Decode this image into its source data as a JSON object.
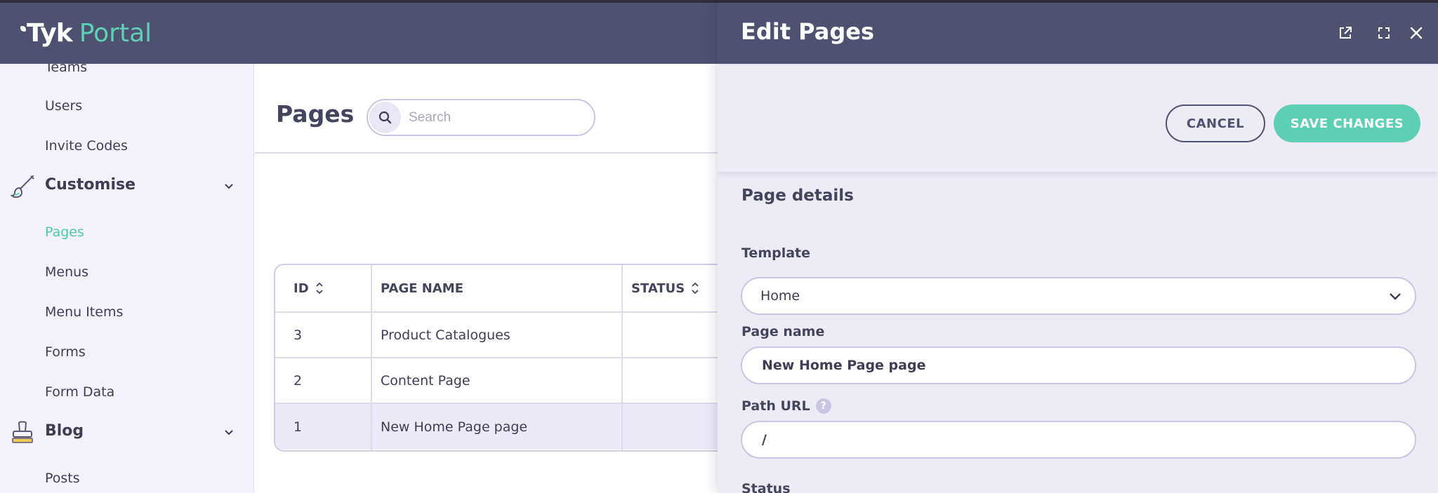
{
  "app": {
    "logo_brand": "Tyk",
    "logo_product": "Portal"
  },
  "sidebar": {
    "items_top": [
      {
        "label": "Teams"
      },
      {
        "label": "Users"
      },
      {
        "label": "Invite Codes"
      }
    ],
    "customise": {
      "label": "Customise",
      "items": [
        {
          "label": "Pages",
          "active": true
        },
        {
          "label": "Menus"
        },
        {
          "label": "Menu Items"
        },
        {
          "label": "Forms"
        },
        {
          "label": "Form Data"
        }
      ]
    },
    "blog": {
      "label": "Blog",
      "items": [
        {
          "label": "Posts"
        }
      ]
    }
  },
  "main": {
    "title": "Pages",
    "search": {
      "placeholder": "Search",
      "value": ""
    },
    "table": {
      "columns": [
        "ID",
        "PAGE NAME",
        "STATUS"
      ],
      "rows": [
        {
          "id": "3",
          "page_name": "Product Catalogues",
          "status": ""
        },
        {
          "id": "2",
          "page_name": "Content Page",
          "status": ""
        },
        {
          "id": "1",
          "page_name": "New Home Page page",
          "status": ""
        }
      ]
    }
  },
  "overlay": {
    "title": "Edit Pages",
    "cancel_label": "CANCEL",
    "save_label": "SAVE CHANGES",
    "section_title": "Page details",
    "template": {
      "label": "Template",
      "value": "Home"
    },
    "page_name": {
      "label": "Page name",
      "value": "New Home Page page"
    },
    "path_url": {
      "label": "Path URL",
      "help": "?",
      "value": "/"
    },
    "status": {
      "label": "Status"
    }
  },
  "colors": {
    "header_bg": "#4f5170",
    "accent": "#5dcfb2",
    "sidebar_bg": "#f3f2fa",
    "overlay_bg": "#edecf5"
  }
}
